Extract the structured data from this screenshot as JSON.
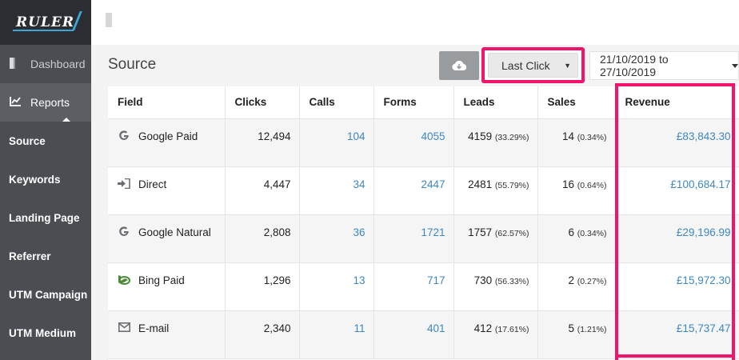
{
  "brand": {
    "logo_text": "RULER"
  },
  "sidebar": {
    "main_items": [
      {
        "label": "Dashboard",
        "icon": "dashboard-icon"
      },
      {
        "label": "Reports",
        "icon": "chart-line-icon"
      }
    ],
    "sub_items": [
      {
        "label": "Source"
      },
      {
        "label": "Keywords"
      },
      {
        "label": "Landing Page"
      },
      {
        "label": "Referrer"
      },
      {
        "label": "UTM Campaign"
      },
      {
        "label": "UTM Medium"
      }
    ]
  },
  "header": {
    "title": "Source",
    "attribution_model": "Last Click",
    "date_range": "21/10/2019 to 27/10/2019"
  },
  "table": {
    "columns": [
      "Field",
      "Clicks",
      "Calls",
      "Forms",
      "Leads",
      "Sales",
      "Revenue"
    ],
    "rows": [
      {
        "field": "Google Paid",
        "icon": "google-icon",
        "clicks": "12,494",
        "calls": "104",
        "forms": "4055",
        "leads": "4159",
        "leads_pct": "(33.29%)",
        "sales": "14",
        "sales_pct": "(0.34%)",
        "revenue": "£83,843.30"
      },
      {
        "field": "Direct",
        "icon": "sign-in-icon",
        "clicks": "4,447",
        "calls": "34",
        "forms": "2447",
        "leads": "2481",
        "leads_pct": "(55.79%)",
        "sales": "16",
        "sales_pct": "(0.64%)",
        "revenue": "£100,684.17"
      },
      {
        "field": "Google Natural",
        "icon": "google-icon",
        "clicks": "2,808",
        "calls": "36",
        "forms": "1721",
        "leads": "1757",
        "leads_pct": "(62.57%)",
        "sales": "6",
        "sales_pct": "(0.34%)",
        "revenue": "£29,196.99"
      },
      {
        "field": "Bing Paid",
        "icon": "bing-icon",
        "clicks": "1,296",
        "calls": "13",
        "forms": "717",
        "leads": "730",
        "leads_pct": "(56.33%)",
        "sales": "2",
        "sales_pct": "(0.27%)",
        "revenue": "£15,972.30"
      },
      {
        "field": "E-mail",
        "icon": "envelope-icon",
        "clicks": "2,340",
        "calls": "11",
        "forms": "401",
        "leads": "412",
        "leads_pct": "(17.61%)",
        "sales": "5",
        "sales_pct": "(1.21%)",
        "revenue": "£15,737.47"
      }
    ]
  },
  "colors": {
    "highlight": "#f2136b",
    "link": "#3d87c3",
    "sidebar": "#4a4d52"
  }
}
